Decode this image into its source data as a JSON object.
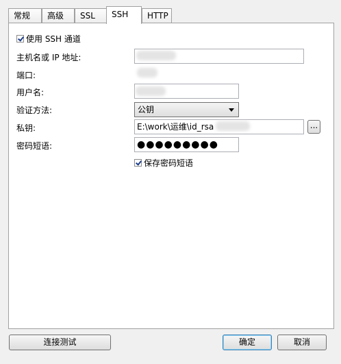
{
  "tabs": [
    {
      "label": "常规"
    },
    {
      "label": "高级"
    },
    {
      "label": "SSL"
    },
    {
      "label": "SSH"
    },
    {
      "label": "HTTP"
    }
  ],
  "active_tab": "SSH",
  "ssh": {
    "use_tunnel_label": "使用 SSH 通道",
    "use_tunnel_checked": true,
    "host_label": "主机名或 IP 地址:",
    "host_value": "",
    "port_label": "端口:",
    "port_value": "",
    "username_label": "用户名:",
    "username_value": "",
    "auth_label": "验证方法:",
    "auth_value": "公钥",
    "private_key_label": "私钥:",
    "private_key_value": "E:\\work\\运维\\id_rsa",
    "browse_label": "...",
    "passphrase_label": "密码短语:",
    "passphrase_value": "●●●●●●●●●",
    "save_passphrase_label": "保存密码短语",
    "save_passphrase_checked": true
  },
  "footer": {
    "test_label": "连接测试",
    "ok_label": "确定",
    "cancel_label": "取消"
  }
}
